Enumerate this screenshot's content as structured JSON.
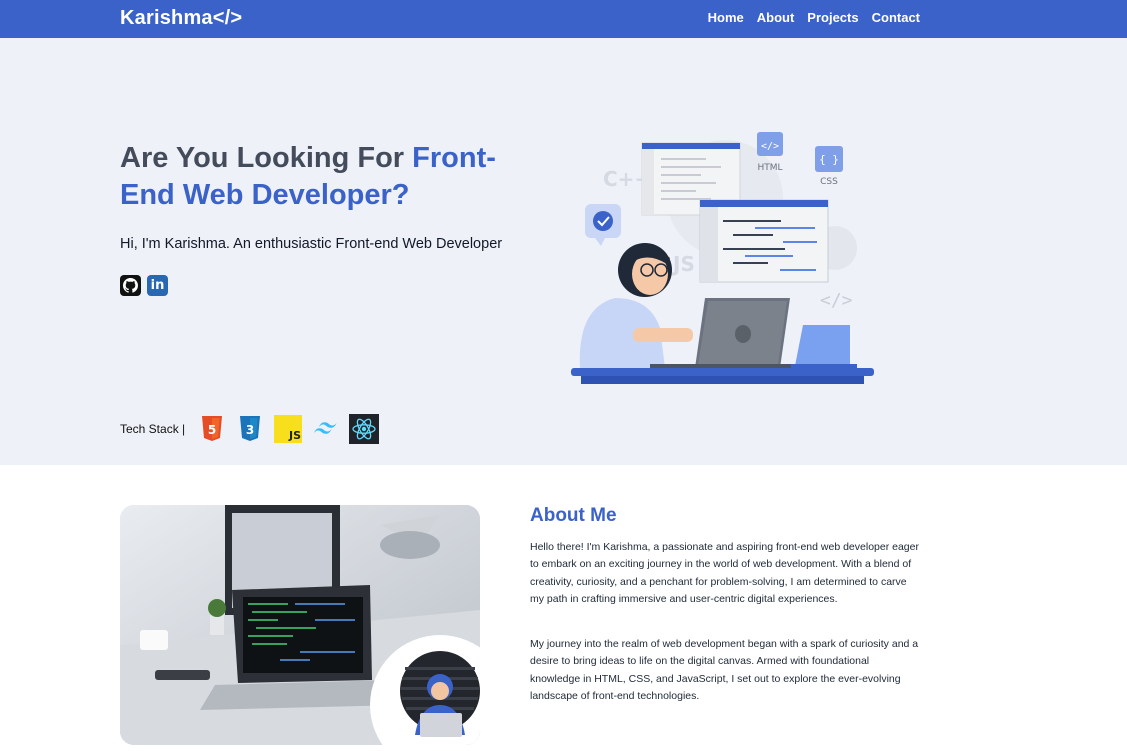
{
  "nav": {
    "brand": "Karishma</>",
    "links": [
      "Home",
      "About",
      "Projects",
      "Contact"
    ]
  },
  "hero": {
    "title_plain": "Are You Looking For ",
    "title_accent": "Front-End Web Developer?",
    "subtitle": "Hi, I'm Karishma. An enthusiastic Front-end Web Developer",
    "socials": [
      {
        "icon": "github-icon"
      },
      {
        "icon": "linkedin-icon",
        "glyph": "in"
      }
    ],
    "tech_label": "Tech Stack |",
    "tech_icons": [
      "html5-icon",
      "css3-icon",
      "javascript-icon",
      "tailwind-icon",
      "react-icon"
    ],
    "illustration": {
      "labels": [
        "HTML",
        "CSS",
        "C++",
        "JS"
      ]
    }
  },
  "about": {
    "title": "About Me",
    "paragraphs": [
      "Hello there! I'm Karishma, a passionate and aspiring front-end web developer eager to embark on an exciting journey in the world of web development. With a blend of creativity, curiosity, and a penchant for problem-solving, I am determined to carve my path in crafting immersive and user-centric digital experiences.",
      "My journey into the realm of web development began with a spark of curiosity and a desire to bring ideas to life on the digital canvas. Armed with foundational knowledge in HTML, CSS, and JavaScript, I set out to explore the ever-evolving landscape of front-end technologies."
    ]
  },
  "colors": {
    "primary": "#3a62c9",
    "hero_bg": "#eef1f8",
    "heading": "#444c5c"
  }
}
